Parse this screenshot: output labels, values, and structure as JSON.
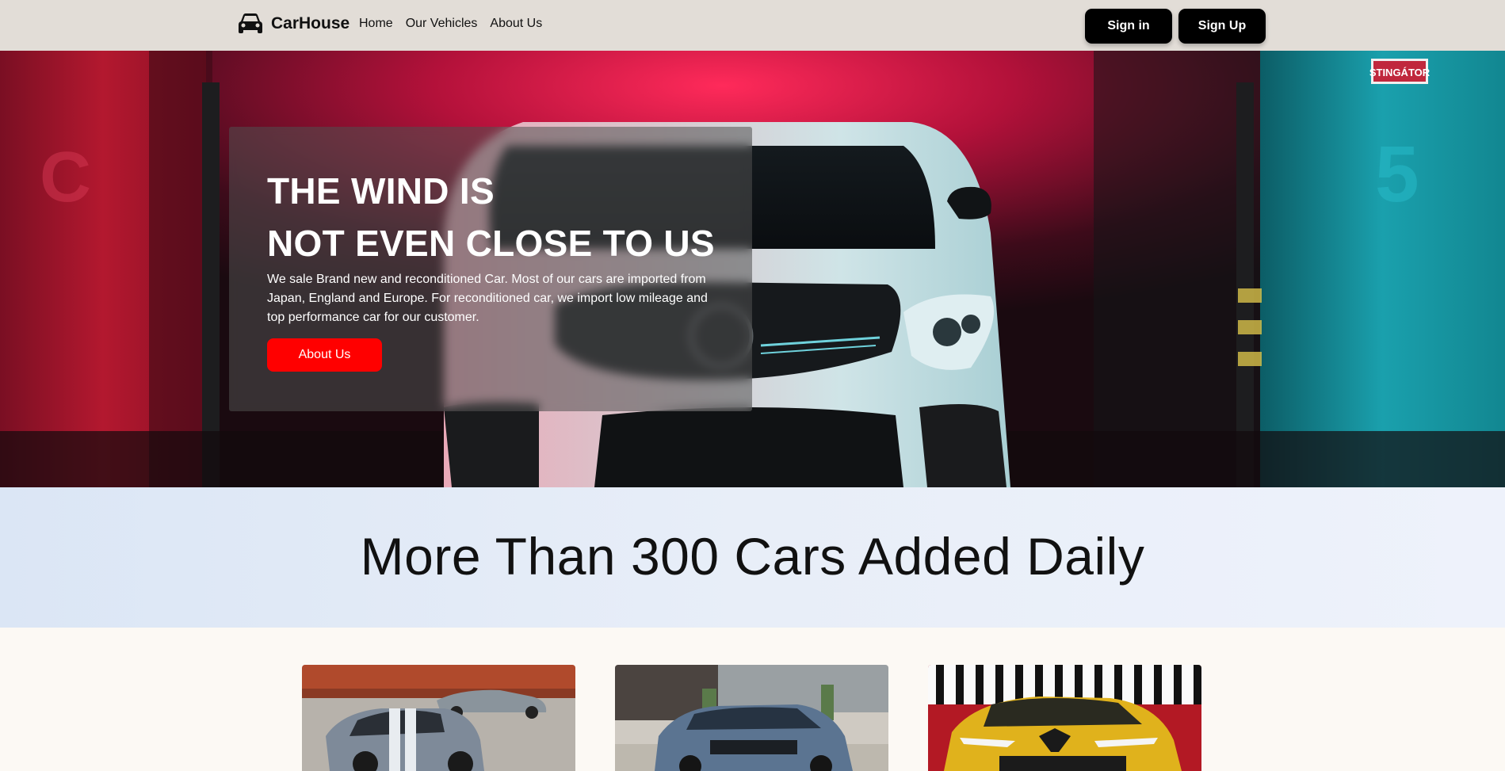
{
  "nav": {
    "brand": "CarHouse",
    "brand_icon": "car-icon",
    "links": [
      "Home",
      "Our Vehicles",
      "About Us"
    ],
    "signin_label": "Sign in",
    "signup_label": "Sign Up"
  },
  "hero": {
    "title_line1": "THE WIND IS",
    "title_line2": "NOT EVEN CLOSE TO US",
    "description": "We sale Brand new and reconditioned Car. Most of our cars are imported from Japan, England and Europe. For reconditioned car, we import low mileage and top performance car for our customer.",
    "button_label": "About Us",
    "sign_text": "STINGÁTOR"
  },
  "banner": {
    "title": "More Than 300 Cars Added Daily"
  },
  "colors": {
    "nav_bg": "#e2ddd7",
    "accent_red": "#ff0000",
    "button_dark": "#000000",
    "page_bg": "#fcf9f4"
  }
}
